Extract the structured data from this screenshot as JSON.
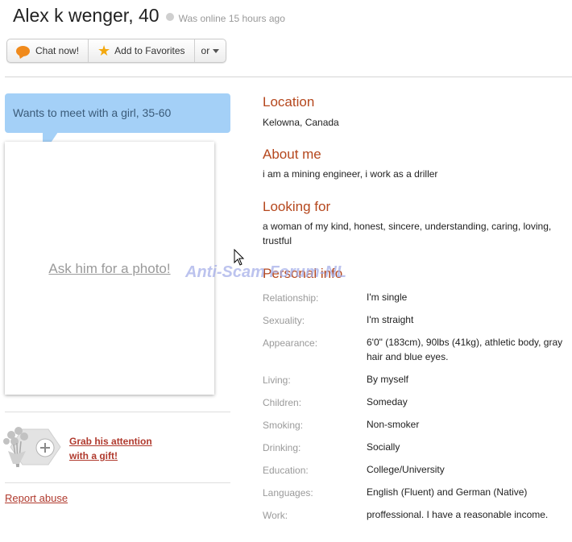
{
  "profile": {
    "name": "Alex k wenger, 40",
    "online_status": "Was online 15 hours ago"
  },
  "actions": {
    "chat_label": "Chat now!",
    "favorites_label": "Add to Favorites",
    "more_label": "or",
    "chat_icon": "chat-bubble-icon",
    "favorites_icon": "star-icon"
  },
  "wants": "Wants to meet with a girl, 35-60",
  "photo": {
    "ask_label": "Ask him for a photo!"
  },
  "gift": {
    "line1": "Grab his attention",
    "line2": "with a gift!"
  },
  "report_label": "Report abuse",
  "watermark": "Anti-Scam Forum-NL",
  "sections": {
    "location_heading": "Location",
    "location_text": "Kelowna, Canada",
    "about_heading": "About me",
    "about_text": "i am a mining engineer, i work as a driller",
    "looking_heading": "Looking for",
    "looking_text": "a woman of my kind, honest, sincere, understanding, caring, loving, trustful",
    "personal_heading": "Personal info"
  },
  "personal_info": [
    {
      "label": "Relationship:",
      "value": "I'm single"
    },
    {
      "label": "Sexuality:",
      "value": "I'm straight"
    },
    {
      "label": "Appearance:",
      "value": "6'0\" (183cm), 90lbs (41kg), athletic body, gray hair and blue eyes."
    },
    {
      "label": "Living:",
      "value": "By myself"
    },
    {
      "label": "Children:",
      "value": "Someday"
    },
    {
      "label": "Smoking:",
      "value": "Non-smoker"
    },
    {
      "label": "Drinking:",
      "value": "Socially"
    },
    {
      "label": "Education:",
      "value": "College/University"
    },
    {
      "label": "Languages:",
      "value": "English (Fluent) and German (Native)"
    },
    {
      "label": "Work:",
      "value": "proffessional. I have a reasonable income."
    }
  ],
  "colors": {
    "heading": "#b5471d",
    "link": "#b03a2e",
    "wants_bg": "#a4d0f7"
  }
}
